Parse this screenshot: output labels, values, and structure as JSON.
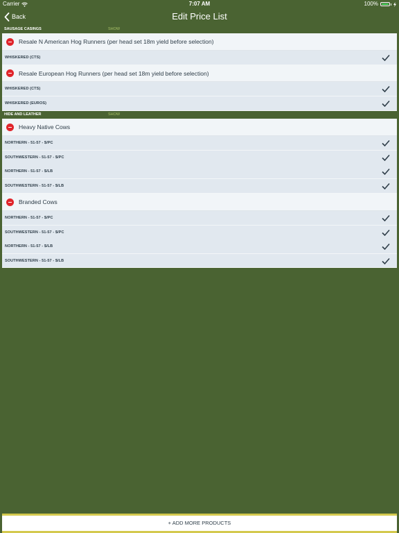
{
  "status_bar": {
    "carrier": "Carrier",
    "time": "7:07 AM",
    "battery": "100%",
    "battery_level": 1.0
  },
  "nav": {
    "back_label": "Back",
    "title": "Edit Price List"
  },
  "sections": [
    {
      "title": "SAUSAGE CASINGS",
      "show_label": "SHOW",
      "products": [
        {
          "name": "Resale N American Hog Runners (per head set 18m yield before selection)",
          "prices": [
            {
              "label": "WHISKERED (CTS)",
              "checked": true
            }
          ]
        },
        {
          "name": "Resale European Hog Runners (per head set 18m yield before selection)",
          "prices": [
            {
              "label": "WHISKERED (CTS)",
              "checked": true
            },
            {
              "label": "WHISKERED (EUROS)",
              "checked": true
            }
          ]
        }
      ]
    },
    {
      "title": "HIDE AND LEATHER",
      "show_label": "SHOW",
      "products": [
        {
          "name": "Heavy Native Cows",
          "prices": [
            {
              "label": "NORTHERN - 51-57 - $/PC",
              "checked": true
            },
            {
              "label": "SOUTHWESTERN - 51-57 - $/PC",
              "checked": true
            },
            {
              "label": "NORTHERN - 51-57 - $/LB",
              "checked": true
            },
            {
              "label": "SOUTHWESTERN - 51-57 - $/LB",
              "checked": true
            }
          ]
        },
        {
          "name": "Branded Cows",
          "prices": [
            {
              "label": "NORTHERN - 51-57 - $/PC",
              "checked": true
            },
            {
              "label": "SOUTHWESTERN - 51-57 - $/PC",
              "checked": true
            },
            {
              "label": "NORTHERN - 51-57 - $/LB",
              "checked": true
            },
            {
              "label": "SOUTHWESTERN - 51-57 - $/LB",
              "checked": true
            }
          ]
        }
      ]
    }
  ],
  "footer": {
    "add_label": "+ ADD MORE PRODUCTS"
  },
  "colors": {
    "background": "#4a6332",
    "remove": "#e0252b",
    "accent_bar": "#d4c94e",
    "show_link": "#a8c267"
  },
  "icons": {
    "back": "chevron-left-icon",
    "remove": "minus-circle-icon",
    "check": "checkmark-icon",
    "wifi": "wifi-icon",
    "battery": "battery-icon"
  }
}
